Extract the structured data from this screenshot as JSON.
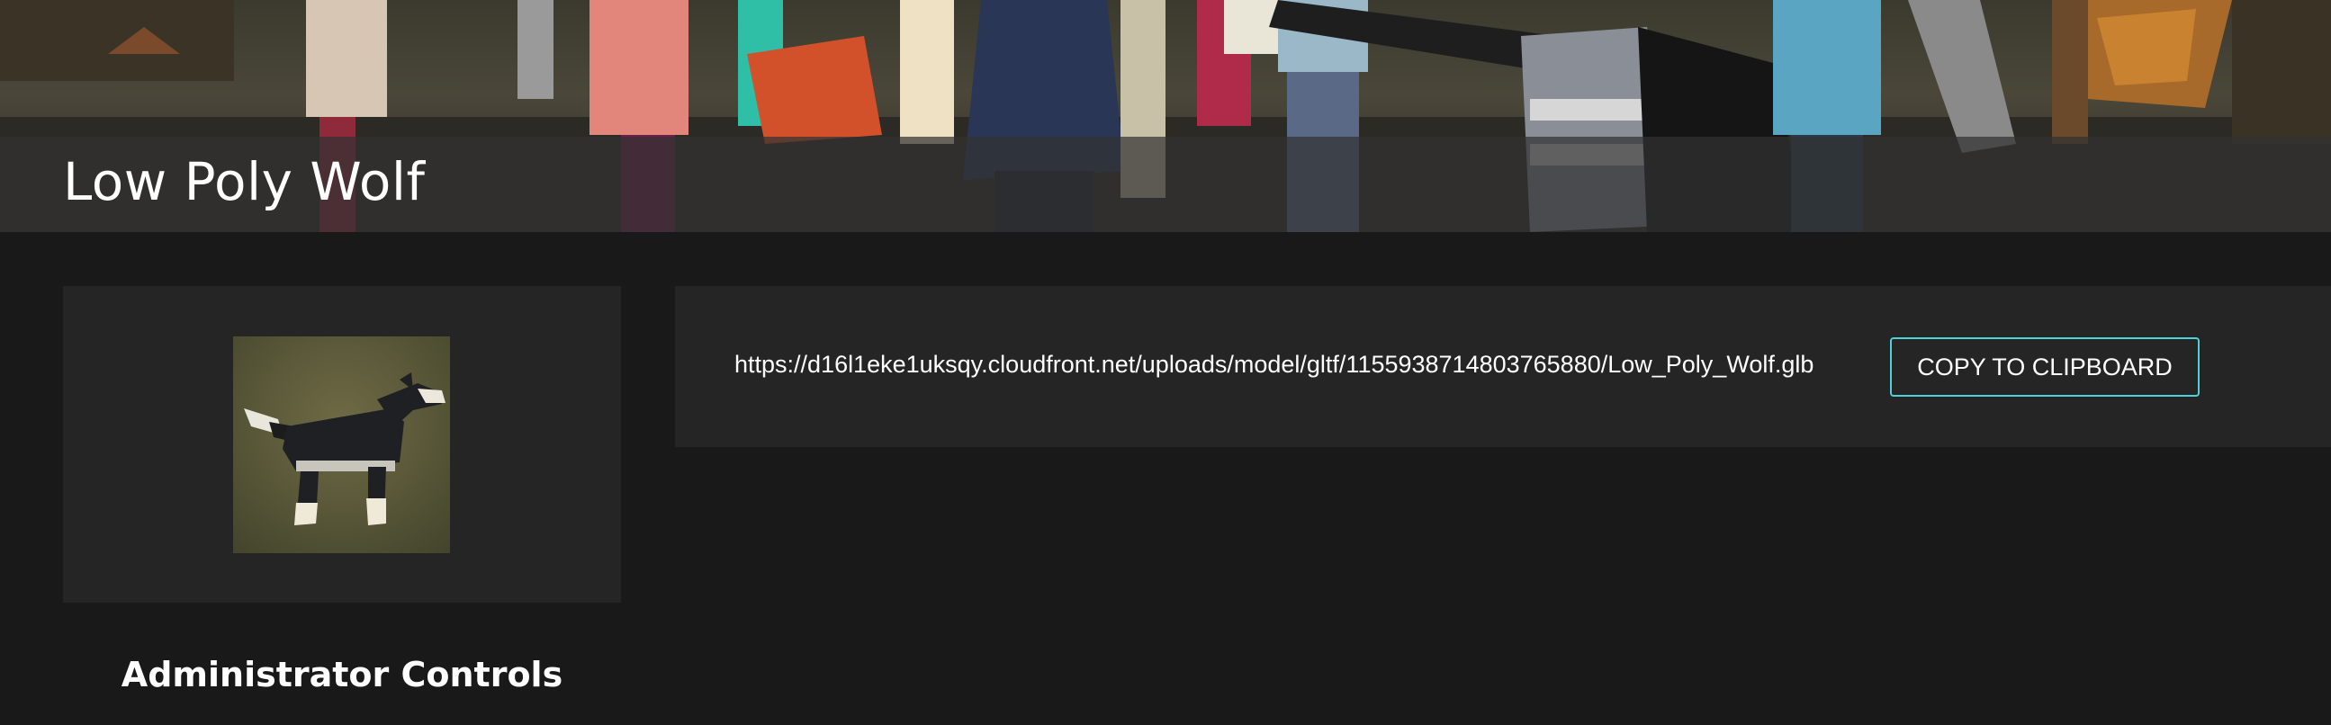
{
  "header": {
    "title": "Low Poly Wolf"
  },
  "thumbnail": {
    "alt": "Low Poly Wolf preview"
  },
  "asset": {
    "url": "https://d16l1eke1uksqy.cloudfront.net/uploads/model/gltf/1155938714803765880/Low_Poly_Wolf.glb",
    "copy_label": "COPY TO CLIPBOARD"
  },
  "admin": {
    "heading": "Administrator Controls"
  },
  "colors": {
    "background": "#191919",
    "panel": "#252525",
    "accent": "#4fd1d9"
  }
}
